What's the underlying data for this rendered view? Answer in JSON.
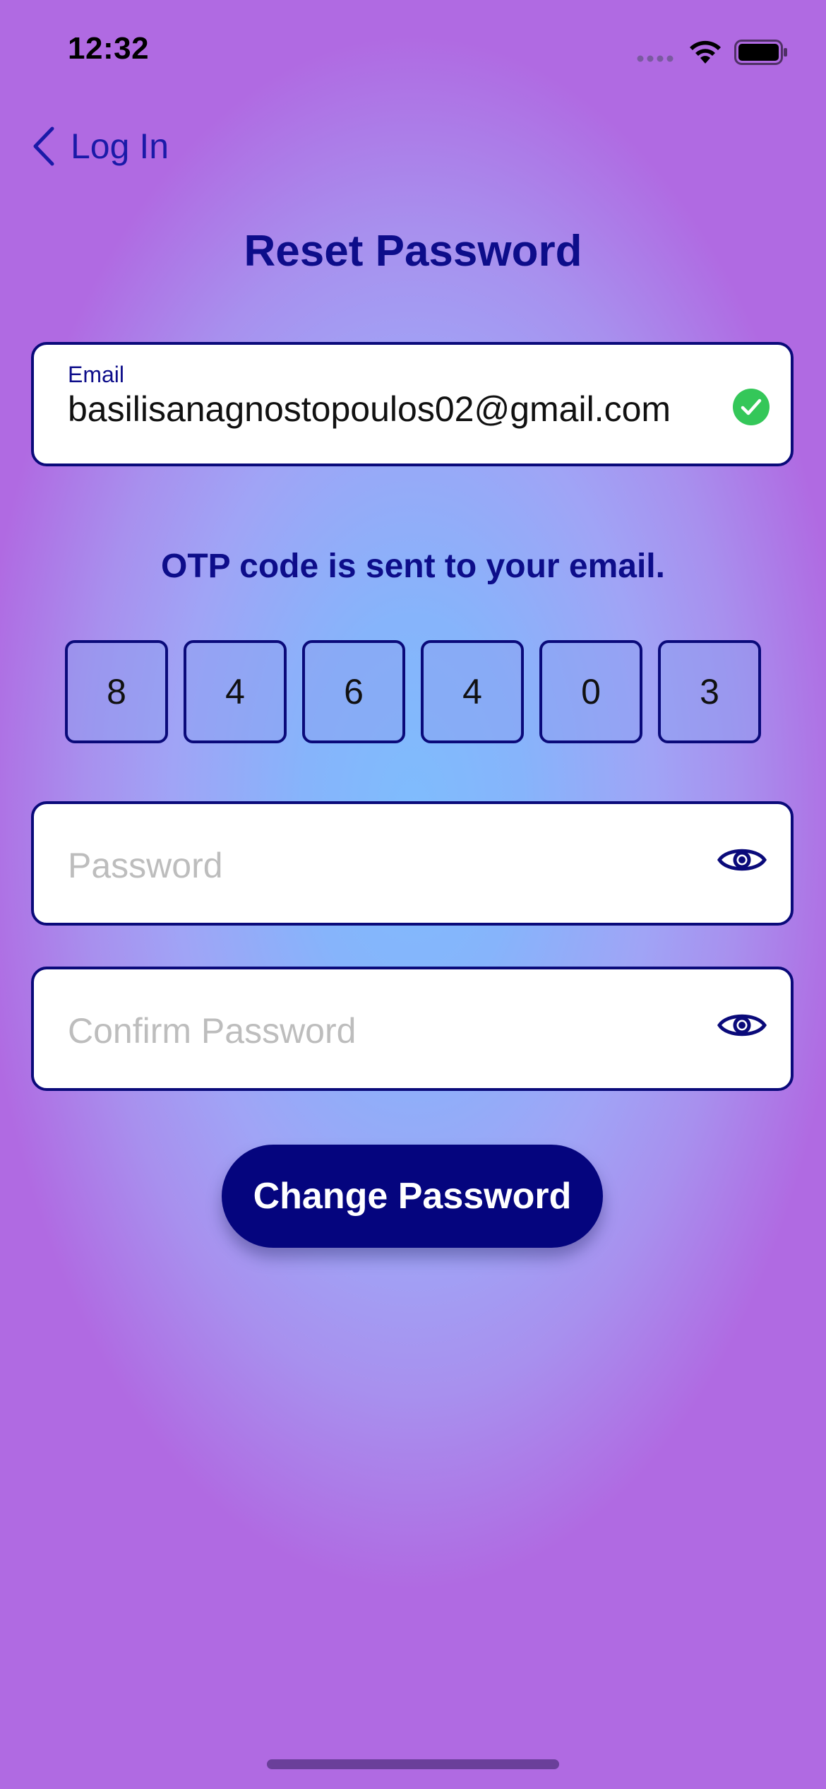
{
  "status_bar": {
    "time": "12:32"
  },
  "nav": {
    "back_label": "Log In"
  },
  "title": "Reset Password",
  "email": {
    "label": "Email",
    "value": "basilisanagnostopoulos02@gmail.com",
    "status_icon": "check-circle-icon",
    "status_color": "#34c759"
  },
  "otp": {
    "message": "OTP code is sent to your email.",
    "digits": [
      "8",
      "4",
      "6",
      "4",
      "0",
      "3"
    ]
  },
  "password": {
    "placeholder": "Password",
    "icon": "eye-icon"
  },
  "confirm_password": {
    "placeholder": "Confirm Password",
    "icon": "eye-icon"
  },
  "actions": {
    "change_label": "Change Password"
  },
  "colors": {
    "primary": "#05057e",
    "accent_text": "#0d0d8a"
  }
}
